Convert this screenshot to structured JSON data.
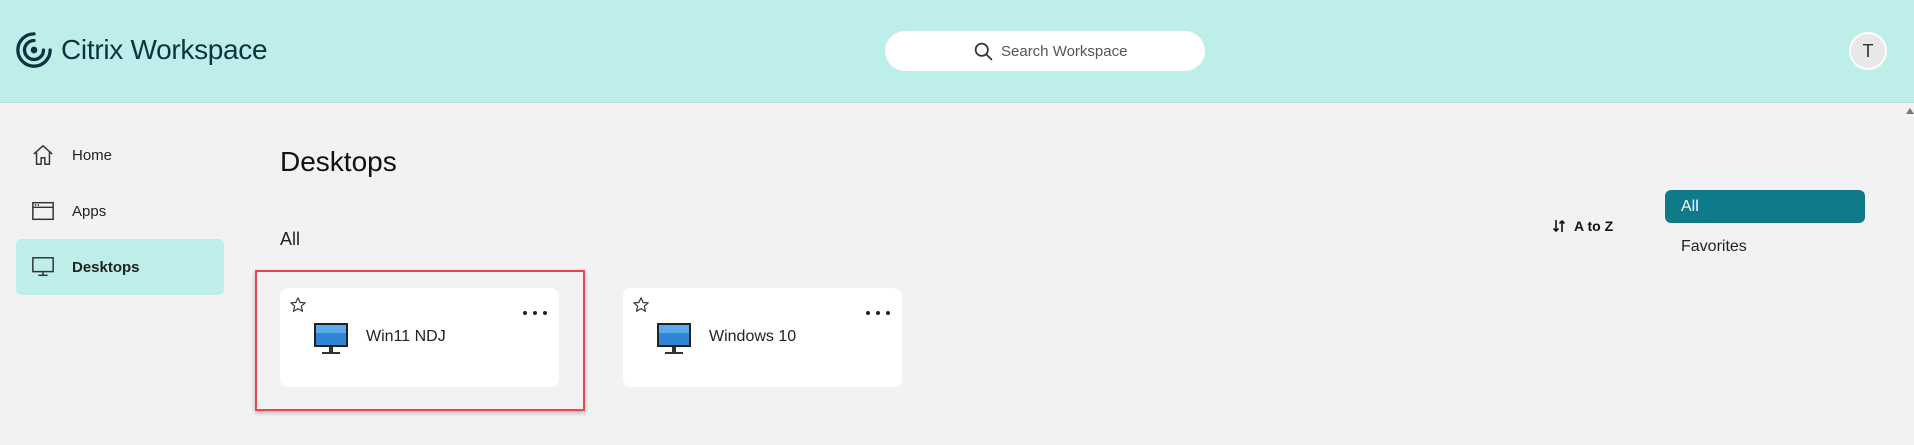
{
  "header": {
    "app_name": "Citrix Workspace",
    "search_placeholder": "Search Workspace",
    "avatar_initial": "T",
    "logo_icon": "citrix-logo-icon"
  },
  "sidebar": {
    "items": [
      {
        "label": "Home",
        "icon": "home-icon"
      },
      {
        "label": "Apps",
        "icon": "apps-window-icon"
      },
      {
        "label": "Desktops",
        "icon": "monitor-icon",
        "active": true
      }
    ]
  },
  "main": {
    "title": "Desktops",
    "section_label": "All",
    "sort_label": "A to Z",
    "filters": [
      {
        "label": "All",
        "active": true
      },
      {
        "label": "Favorites",
        "active": false
      }
    ],
    "desktops": [
      {
        "name": "Win11 NDJ",
        "favorite": false,
        "highlighted": true
      },
      {
        "name": "Windows 10",
        "favorite": false,
        "highlighted": false
      }
    ]
  },
  "colors": {
    "header_bg": "#bdeeea",
    "accent": "#0e7a8a",
    "highlight_border": "#e5484d",
    "page_bg": "#f2f2f2"
  }
}
